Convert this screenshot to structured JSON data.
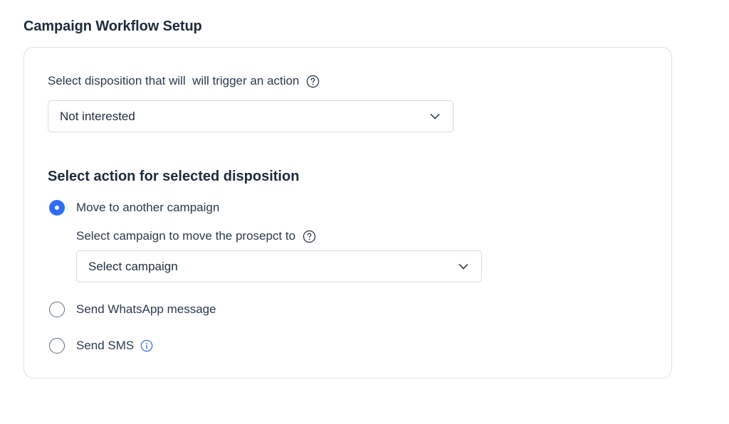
{
  "page": {
    "title": "Campaign Workflow Setup"
  },
  "disposition": {
    "label": "Select disposition that will  will trigger an action",
    "selected_value": "Not interested"
  },
  "action_section": {
    "heading": "Select action for selected disposition",
    "options": [
      {
        "label": "Move to another campaign",
        "checked": true
      },
      {
        "label": "Send WhatsApp message",
        "checked": false
      },
      {
        "label": "Send SMS",
        "checked": false
      }
    ],
    "campaign": {
      "label": "Select campaign to move the prosepct to",
      "placeholder": "Select campaign"
    }
  },
  "icons": {
    "help": "question-circle-icon",
    "dropdown": "chevron-down-icon",
    "info": "info-circle-icon"
  },
  "colors": {
    "accent": "#2f6df6",
    "text": "#1f2d3d",
    "border": "#d6dbe1"
  }
}
